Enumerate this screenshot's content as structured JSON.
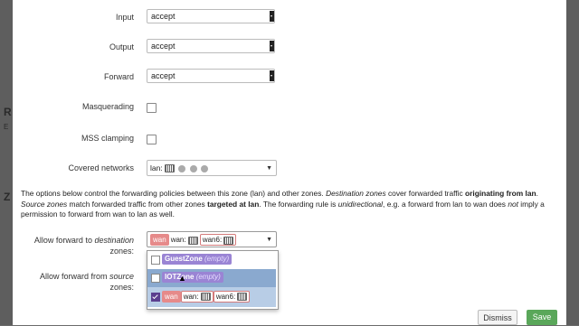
{
  "background": {
    "heading_fragment": "R",
    "sub_fragment": "E",
    "side_fragment": "Z"
  },
  "zone_policies": [
    {
      "label": "Input",
      "value": "accept"
    },
    {
      "label": "Output",
      "value": "accept"
    },
    {
      "label": "Forward",
      "value": "accept"
    }
  ],
  "masquerading": {
    "label": "Masquerading",
    "checked": false
  },
  "mss_clamping": {
    "label": "MSS clamping",
    "checked": false
  },
  "covered_networks": {
    "label": "Covered networks",
    "value": "lan:"
  },
  "description": {
    "p1": "The options below control the forwarding policies between this zone (lan) and other zones. ",
    "p2": "Destination zones",
    "p3": " cover forwarded traffic ",
    "p4": "originating from lan",
    "p5": ". ",
    "p6": "Source zones",
    "p7": " match forwarded traffic from other zones ",
    "p8": "targeted at lan",
    "p9": ". The forwarding rule is ",
    "p10": "unidirectional",
    "p11": ", e.g. a forward from lan to wan does ",
    "p12": "not",
    "p13": " imply a permission to forward from wan to lan as well."
  },
  "allow_forward_dest": {
    "label_line1": "Allow forward to ",
    "label_em": "destination",
    "label_line2": "zones:",
    "selected": {
      "zone": "wan",
      "nets": [
        "wan:",
        "wan6:"
      ]
    }
  },
  "allow_forward_src": {
    "label_line1": "Allow forward from ",
    "label_em": "source",
    "label_line2": "zones:"
  },
  "dropdown_options": [
    {
      "name": "GuestZone",
      "note": "(empty)",
      "checked": false
    },
    {
      "name": "IOTZone",
      "note": "(empty)",
      "checked": false
    },
    {
      "name": "wan",
      "nets": [
        "wan:",
        "wan6:"
      ],
      "checked": true
    }
  ],
  "buttons": {
    "dismiss": "Dismiss",
    "save": "Save"
  },
  "colors": {
    "save": "#5aa75a",
    "wan_zone": "#e68a8a",
    "guest_zone": "#9a84d4",
    "selected_row": "#8aa9cf"
  }
}
